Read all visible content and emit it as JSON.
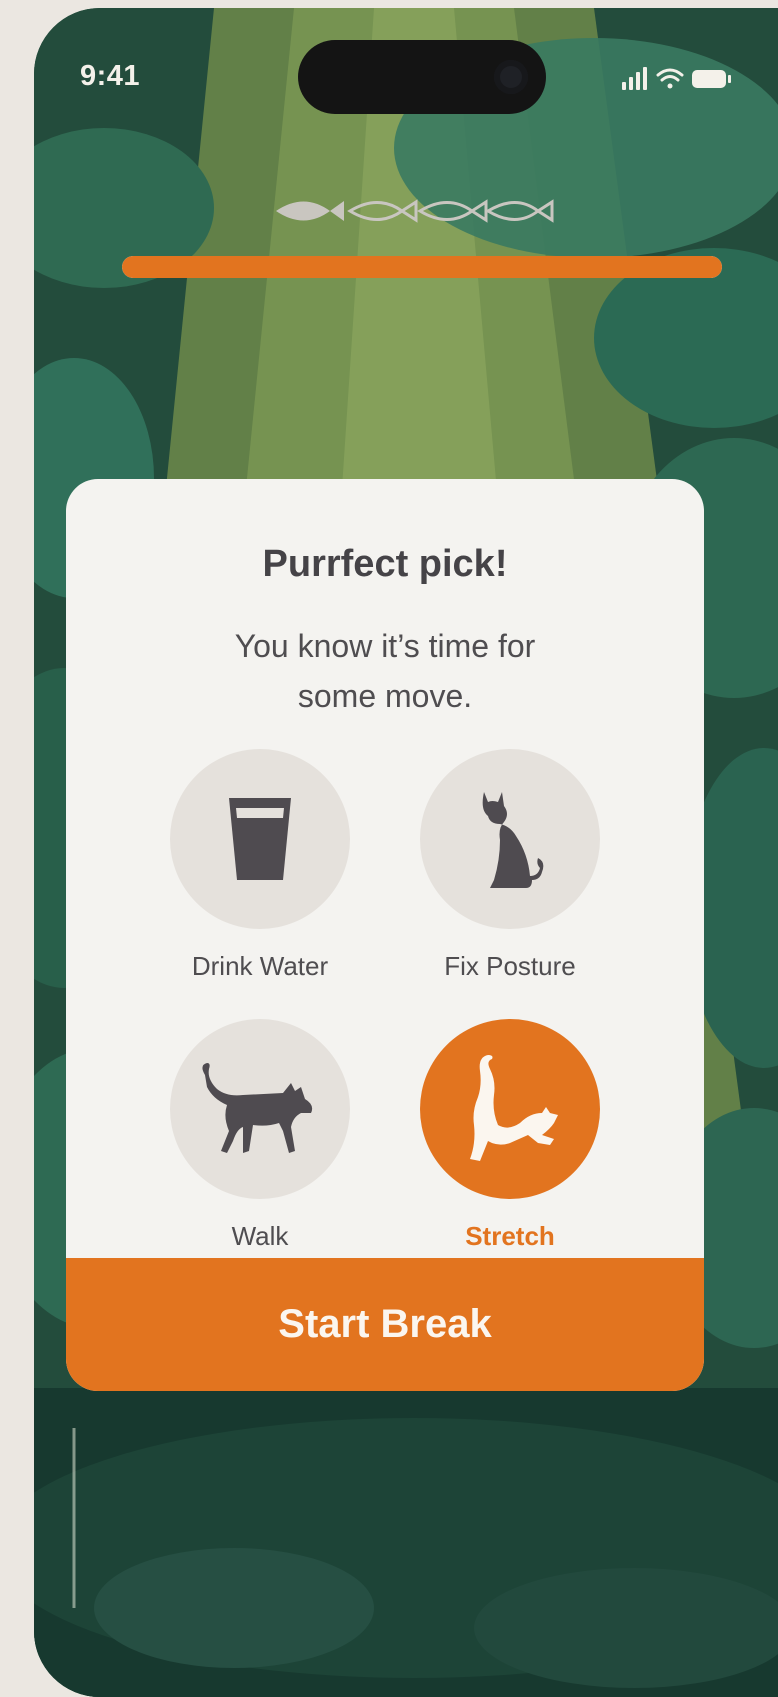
{
  "status_bar": {
    "time": "9:41"
  },
  "progress": {
    "fraction": 1.0,
    "color": "#e2741f"
  },
  "fish_indicator": {
    "filled": 1,
    "total": 4
  },
  "card": {
    "title": "Purrfect pick!",
    "subtitle": "You know it’s time for some move.",
    "options": [
      {
        "label": "Drink Water",
        "icon": "glass-icon",
        "selected": false
      },
      {
        "label": "Fix Posture",
        "icon": "sitting-cat-icon",
        "selected": false
      },
      {
        "label": "Walk",
        "icon": "walking-cat-icon",
        "selected": false
      },
      {
        "label": "Stretch",
        "icon": "stretching-cat-icon",
        "selected": true
      }
    ],
    "button_label": "Start Break"
  },
  "colors": {
    "accent": "#e2741f",
    "card_bg": "#f4f3f0",
    "icon_dark": "#4f4b50",
    "option_bg": "#e5e1dc",
    "forest": "#234c3c"
  }
}
